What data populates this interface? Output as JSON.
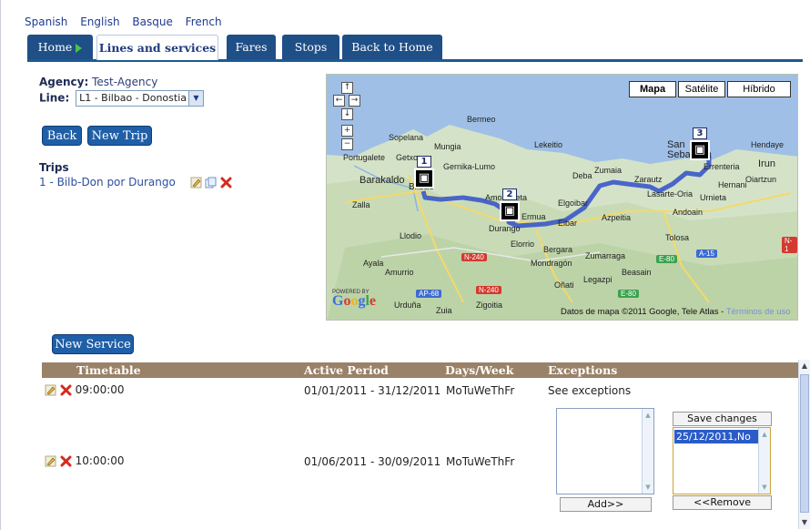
{
  "languages": [
    "Spanish",
    "English",
    "Basque",
    "French"
  ],
  "tabs": {
    "home": "Home",
    "lines": "Lines and services",
    "fares": "Fares",
    "stops": "Stops",
    "back_home": "Back to Home"
  },
  "agency": {
    "label": "Agency:",
    "value": "Test-Agency"
  },
  "line": {
    "label": "Line:",
    "selected": "L1 - Bilbao - Donostia"
  },
  "buttons": {
    "back": "Back",
    "new_trip": "New Trip",
    "new_service": "New Service"
  },
  "trips": {
    "title": "Trips",
    "items": [
      "1 - Bilb-Don por Durango"
    ]
  },
  "map": {
    "types": [
      "Mapa",
      "Satélite",
      "Híbrido"
    ],
    "selected_type": "Mapa",
    "stops": [
      "1",
      "2",
      "3"
    ],
    "towns": [
      "Bermeo",
      "Sopelana",
      "Mungia",
      "Portugalete",
      "Getxo",
      "Gernika-Lumo",
      "Lekeitio",
      "Barakaldo",
      "Bilbao",
      "Zalla",
      "Amorebieta",
      "Amurrio",
      "Ermua",
      "Durango",
      "Elgoibar",
      "Eibar",
      "Azpeitia",
      "Llodio",
      "Elorrio",
      "Bergara",
      "Zumarraga",
      "Mondragón",
      "Oñati",
      "Legazpi",
      "Beasain",
      "Tolosa",
      "Ayala",
      "Zuia",
      "Zigoitia",
      "Urduña",
      "Deba",
      "Zumaia",
      "Zarautz",
      "Lasarte-Oria",
      "Andoain",
      "Urnieta",
      "Hernani",
      "Oiartzun",
      "Errenteria",
      "San Sebastián",
      "Hendaye",
      "Irun"
    ],
    "roads": [
      "N-240",
      "N-240",
      "AP-68",
      "E-80",
      "A-15",
      "E-80",
      "N-1"
    ],
    "powered_by": "POWERED BY",
    "logo": "Google",
    "attribution": "Datos de mapa ©2011 Google, Tele Atlas -",
    "terms_link": "Términos de uso"
  },
  "services": {
    "headers": [
      "Timetable",
      "Active Period",
      "Days/Week",
      "Exceptions"
    ],
    "rows": [
      {
        "timetable": "09:00:00",
        "period": "01/01/2011 - 31/12/2011",
        "days": "MoTuWeThFr",
        "exceptions": "See exceptions"
      },
      {
        "timetable": "10:00:00",
        "period": "01/06/2011 - 30/09/2011",
        "days": "MoTuWeThFr"
      }
    ],
    "exceptions_editor": {
      "save": "Save changes",
      "add": "Add>>",
      "remove": "<<Remove",
      "selected_items": [
        "25/12/2011,No"
      ]
    }
  },
  "colors": {
    "tab_bg": "#1f4f87",
    "button_bg": "#1f5fa8",
    "table_header": "#9a8268",
    "route": "#3b57c9"
  }
}
